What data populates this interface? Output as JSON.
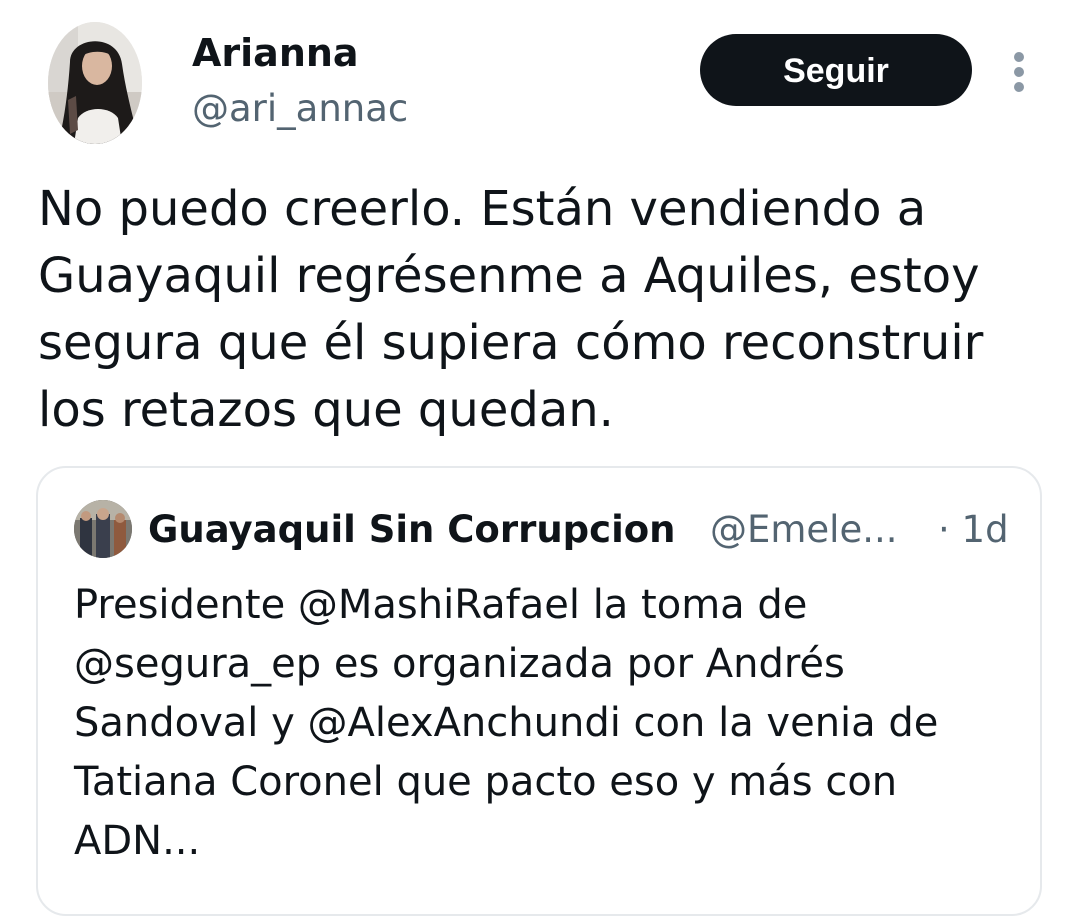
{
  "tweet": {
    "author": {
      "display_name": "Arianna",
      "handle": "@ari_annac",
      "avatar": "profile-photo"
    },
    "follow_label": "Seguir",
    "more_icon": "more-vertical-icon",
    "text": "No puedo creerlo. Están vendiendo a\nGuayaquil   regrésenme a Aquiles, estoy\nsegura que él supiera cómo reconstruir\nlos retazos que quedan."
  },
  "quote": {
    "author": {
      "display_name": "Guayaquil Sin Corrupcion",
      "handle": "@Emele...",
      "avatar": "profile-photo"
    },
    "time": "· 1d",
    "text": "Presidente @MashiRafael la toma de\n@segura_ep es organizada por Andrés\nSandoval y @AlexAnchundi con la venia de\nTatiana Coronel que pacto eso y más con\nADN..."
  },
  "colors": {
    "text_primary": "#0f1419",
    "text_secondary": "#536471",
    "button_bg": "#0f1419",
    "button_text": "#ffffff",
    "card_border": "#e6e9ec"
  }
}
